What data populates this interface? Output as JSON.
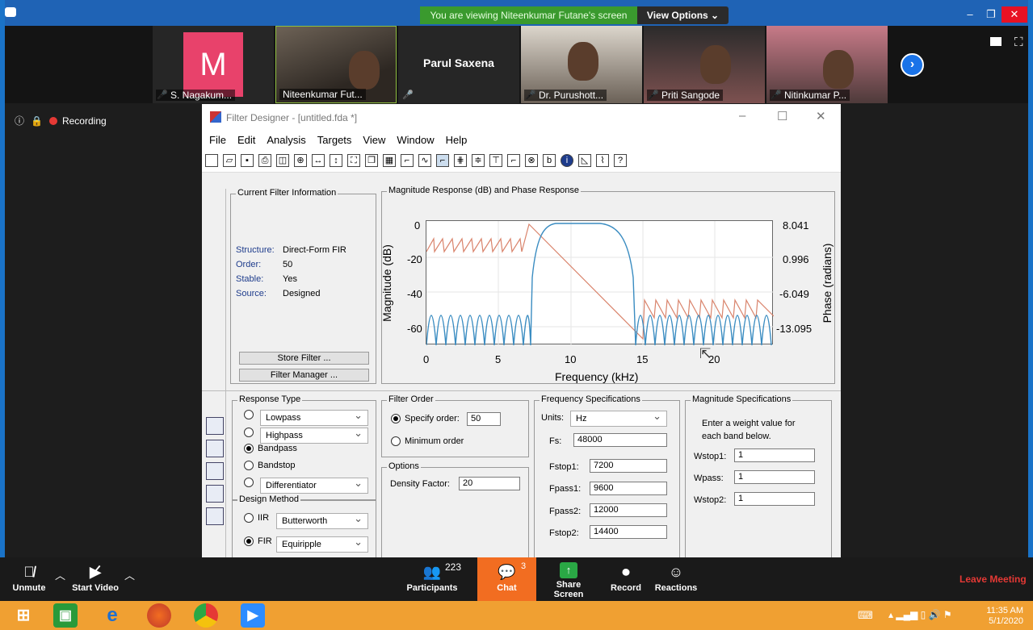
{
  "banner": {
    "viewing": "You are viewing Niteenkumar Futane's screen",
    "view_options": "View Options ⌄"
  },
  "window_controls": {
    "min": "–",
    "restore": "❐",
    "close": "✕"
  },
  "participants": [
    {
      "name": "S. Nagakum...",
      "initial": "M"
    },
    {
      "name": "Niteenkumar Fut..."
    },
    {
      "name": "Parul Saxena"
    },
    {
      "name": "Dr. Purushott..."
    },
    {
      "name": "Priti Sangode"
    },
    {
      "name": "Nitinkumar P..."
    }
  ],
  "recording": "Recording",
  "filter_designer": {
    "title": "Filter Designer -  [untitled.fda *]",
    "menu": [
      "File",
      "Edit",
      "Analysis",
      "Targets",
      "View",
      "Window",
      "Help"
    ],
    "current_info": {
      "caption": "Current Filter Information",
      "labels": [
        "Structure:",
        "Order:",
        "Stable:",
        "Source:"
      ],
      "values": [
        "Direct-Form FIR",
        "50",
        "Yes",
        "Designed"
      ],
      "store_button": "Store Filter ...",
      "manager_button": "Filter Manager ..."
    },
    "plot": {
      "caption": "Magnitude Response (dB) and Phase Response",
      "ylabel": "Magnitude (dB)",
      "y2label": "Phase (radians)",
      "xlabel": "Frequency (kHz)",
      "yticks": [
        "0",
        "-20",
        "-40",
        "-60"
      ],
      "y2ticks": [
        "8.041",
        "0.996",
        "-6.049",
        "-13.095"
      ],
      "xticks": [
        "0",
        "5",
        "10",
        "15",
        "20"
      ]
    },
    "response_type": {
      "caption": "Response Type",
      "lowpass": "Lowpass",
      "highpass": "Highpass",
      "bandpass": "Bandpass",
      "bandstop": "Bandstop",
      "differentiator": "Differentiator"
    },
    "design_method": {
      "caption": "Design Method",
      "iir": "IIR",
      "iir_value": "Butterworth",
      "fir": "FIR",
      "fir_value": "Equiripple"
    },
    "filter_order": {
      "caption": "Filter Order",
      "specify": "Specify order:",
      "specify_value": "50",
      "minimum": "Minimum order"
    },
    "options": {
      "caption": "Options",
      "density_label": "Density Factor:",
      "density_value": "20"
    },
    "freq_spec": {
      "caption": "Frequency Specifications",
      "units_label": "Units:",
      "units_value": "Hz",
      "fs_label": "Fs:",
      "fs_value": "48000",
      "fstop1_label": "Fstop1:",
      "fstop1_value": "7200",
      "fpass1_label": "Fpass1:",
      "fpass1_value": "9600",
      "fpass2_label": "Fpass2:",
      "fpass2_value": "12000",
      "fstop2_label": "Fstop2:",
      "fstop2_value": "14400"
    },
    "mag_spec": {
      "caption": "Magnitude Specifications",
      "hint1": "Enter a weight value for",
      "hint2": "each band below.",
      "wstop1_label": "Wstop1:",
      "wstop1_value": "1",
      "wpass_label": "Wpass:",
      "wpass_value": "1",
      "wstop2_label": "Wstop2:",
      "wstop2_value": "1"
    }
  },
  "controls": {
    "unmute": "Unmute",
    "start_video": "Start Video",
    "participants_count": "223",
    "participants": "Participants",
    "chat_count": "3",
    "chat": "Chat",
    "share_screen": "Share Screen",
    "record": "Record",
    "reactions": "Reactions",
    "leave": "Leave Meeting"
  },
  "taskbar": {
    "time": "11:35 AM",
    "date": "5/1/2020"
  },
  "colors": {
    "zoom_blue": "#1f63b5",
    "chat_orange": "#f26d21",
    "leave_red": "#e53935",
    "banner_green": "#3a9a2e"
  }
}
